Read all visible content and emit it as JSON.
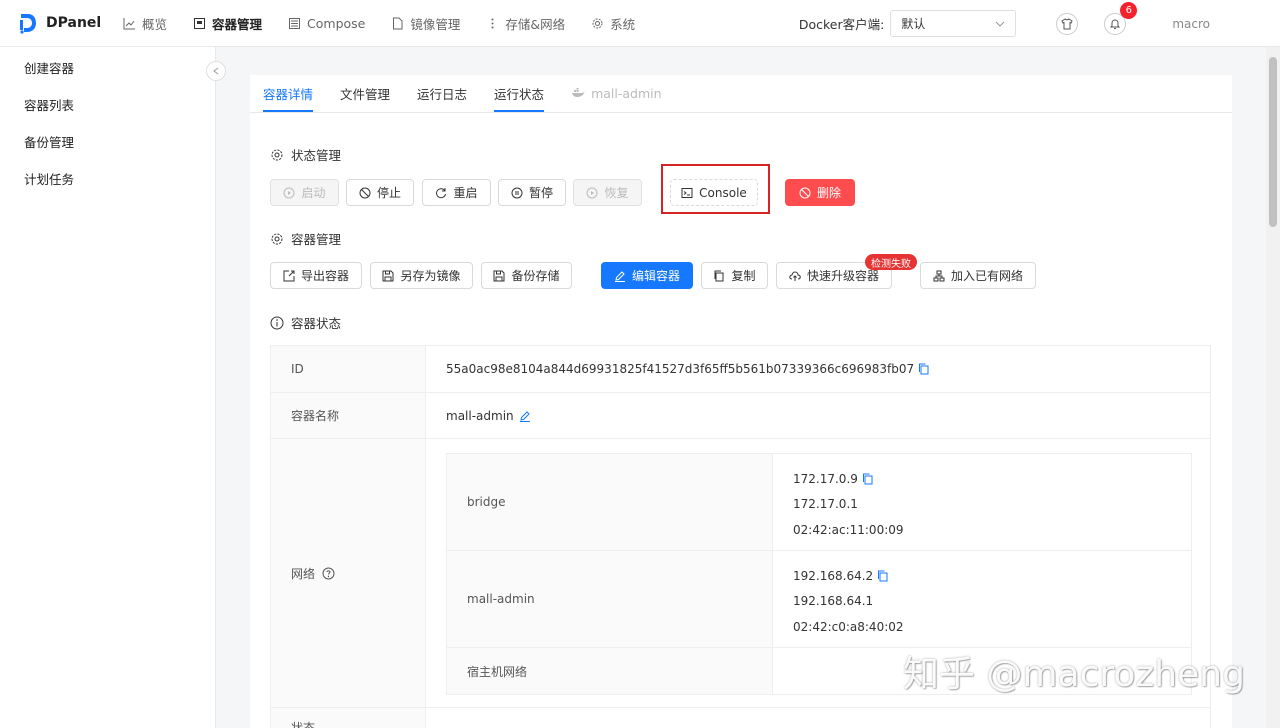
{
  "app": {
    "name": "DPanel"
  },
  "nav": [
    {
      "label": "概览",
      "icon": "chart-icon",
      "active": false
    },
    {
      "label": "容器管理",
      "icon": "container-icon",
      "active": true
    },
    {
      "label": "Compose",
      "icon": "compose-icon",
      "active": false
    },
    {
      "label": "镜像管理",
      "icon": "file-icon",
      "active": false
    },
    {
      "label": "存储&网络",
      "icon": "more-icon",
      "active": false
    },
    {
      "label": "系统",
      "icon": "gear-icon",
      "active": false
    }
  ],
  "header": {
    "docker_label": "Docker客户端:",
    "docker_value": "默认",
    "notification_count": "6",
    "user": "macro"
  },
  "sidebar": {
    "items": [
      {
        "label": "创建容器"
      },
      {
        "label": "容器列表"
      },
      {
        "label": "备份管理"
      },
      {
        "label": "计划任务"
      }
    ]
  },
  "tabs": [
    {
      "label": "容器详情",
      "state": "active"
    },
    {
      "label": "文件管理",
      "state": "normal"
    },
    {
      "label": "运行日志",
      "state": "normal"
    },
    {
      "label": "运行状态",
      "state": "underline"
    },
    {
      "label": "mall-admin",
      "state": "disabled"
    }
  ],
  "state_section": {
    "title": "状态管理",
    "buttons": {
      "start": "启动",
      "stop": "停止",
      "restart": "重启",
      "pause": "暂停",
      "resume": "恢复",
      "console": "Console",
      "delete": "删除"
    }
  },
  "manage_section": {
    "title": "容器管理",
    "buttons": {
      "export": "导出容器",
      "save_image": "另存为镜像",
      "backup": "备份存储",
      "edit": "编辑容器",
      "copy": "复制",
      "upgrade": "快速升级容器",
      "upgrade_badge": "检测失败",
      "join_network": "加入已有网络"
    }
  },
  "status_section": {
    "title": "容器状态",
    "id_label": "ID",
    "id_value": "55a0ac98e8104a844d69931825f41527d3f65ff5b561b07339366c696983fb07",
    "name_label": "容器名称",
    "name_value": "mall-admin",
    "network_label": "网络",
    "networks": [
      {
        "name": "bridge",
        "ip": "172.17.0.9",
        "gateway": "172.17.0.1",
        "mac": "02:42:ac:11:00:09"
      },
      {
        "name": "mall-admin",
        "ip": "192.168.64.2",
        "gateway": "192.168.64.1",
        "mac": "02:42:c0:a8:40:02"
      }
    ],
    "host_network_label": "宿主机网络",
    "next_label": "状态"
  },
  "watermark": "知乎 @macrozheng",
  "colors": {
    "primary": "#1677ff",
    "danger": "#ff4d4f",
    "highlight": "#d42424"
  }
}
